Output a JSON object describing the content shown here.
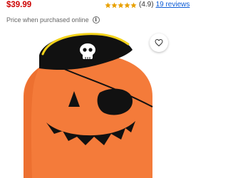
{
  "product": {
    "price": "$39.99",
    "rating_value": "(4.9)",
    "rating_stars": 5,
    "reviews_link": "19 reviews",
    "price_note": "Price when purchased online",
    "info_glyph": "i"
  },
  "colors": {
    "price": "#cc0000",
    "star": "#e8a000",
    "link": "#0a5ad6",
    "pumpkin": "#f47b3a",
    "hat": "#111111",
    "hat_trim": "#f2d21b"
  },
  "icons": {
    "favorite": "heart-icon",
    "info": "info-icon",
    "rating": "star-icon"
  }
}
